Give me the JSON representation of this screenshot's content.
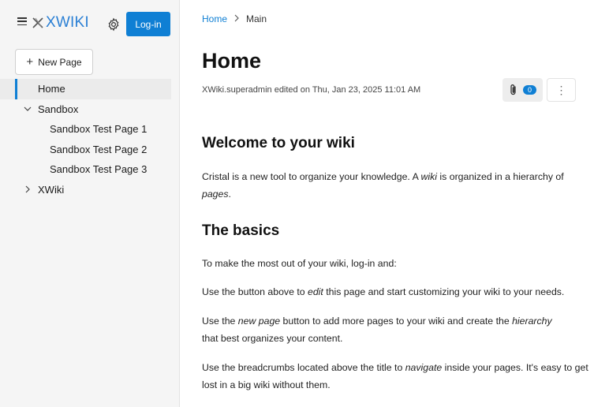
{
  "sidebar": {
    "logo_text": "XWIKI",
    "login_label": "Log-in",
    "new_page_label": "New Page",
    "tree": [
      {
        "label": "Home",
        "selected": true
      },
      {
        "label": "Sandbox",
        "expanded": true
      },
      {
        "label": "Sandbox Test Page 1"
      },
      {
        "label": "Sandbox Test Page 2"
      },
      {
        "label": "Sandbox Test Page 3"
      },
      {
        "label": "XWiki",
        "expanded": false
      }
    ]
  },
  "breadcrumb": {
    "home": "Home",
    "current": "Main"
  },
  "page": {
    "title": "Home",
    "meta": "XWiki.superadmin edited on Thu, Jan 23, 2025 11:01 AM",
    "attachment_count": "0"
  },
  "content": {
    "h_welcome": "Welcome to your wiki",
    "p1_a": "Cristal is a new tool to organize your knowledge. A ",
    "p1_em1": "wiki",
    "p1_b": " is organized in a hierarchy of ",
    "p1_em2": "pages",
    "p1_c": ".",
    "h_basics": "The basics",
    "p2": "To make the most out of your wiki, log-in and:",
    "p3_a": "Use the button above to ",
    "p3_em": "edit",
    "p3_b": " this page and start customizing your wiki to your needs.",
    "p4_a": "Use the ",
    "p4_em1": "new page",
    "p4_b": " button to add more pages to your wiki and create the ",
    "p4_em2": "hierarchy",
    "p4_c": " that best organizes your content.",
    "p5_a": "Use the breadcrumbs located above the title to ",
    "p5_em": "navigate",
    "p5_b": " inside your pages. It's easy to get lost in a big wiki without them."
  },
  "colors": {
    "accent": "#0f7fd4",
    "sidebar_bg": "#f5f5f5"
  }
}
